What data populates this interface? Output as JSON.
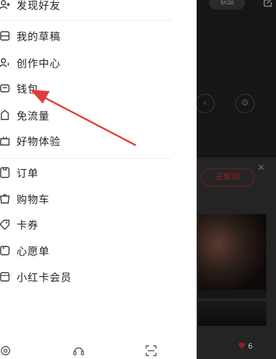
{
  "menu": {
    "group1": [
      {
        "label": "发现好友",
        "icon": "add-friend-icon"
      },
      {
        "label": "我的草稿",
        "icon": "draft-icon"
      },
      {
        "label": "创作中心",
        "icon": "sparkle-icon"
      },
      {
        "label": "钱包",
        "icon": "wallet-icon"
      },
      {
        "label": "免流量",
        "icon": "data-free-icon"
      },
      {
        "label": "好物体验",
        "icon": "gift-icon"
      }
    ],
    "group2": [
      {
        "label": "订单",
        "icon": "order-icon"
      },
      {
        "label": "购物车",
        "icon": "cart-icon"
      },
      {
        "label": "卡券",
        "icon": "coupon-icon"
      },
      {
        "label": "心愿单",
        "icon": "wishlist-icon"
      },
      {
        "label": "小红卡会员",
        "icon": "membership-icon"
      }
    ]
  },
  "bottom_bar": [
    "settings-icon",
    "help-icon",
    "scan-icon"
  ],
  "background": {
    "top_pill": "联国",
    "unlock_button": "去解锁",
    "likes_count": "6"
  },
  "colors": {
    "arrow": "#e23b3b",
    "drawer_bg": "#ffffff",
    "overlay": "#1c1c1c"
  }
}
